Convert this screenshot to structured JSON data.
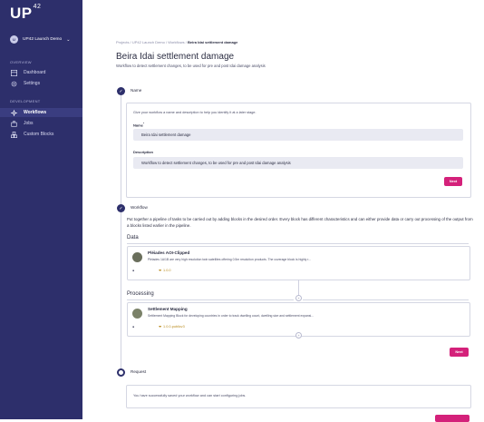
{
  "sidebar": {
    "logo": "UP",
    "logo_sup": "42",
    "project": {
      "initial": "U",
      "name": "UP42 Launch Demo"
    },
    "sections": [
      {
        "label": "OVERVIEW",
        "items": [
          {
            "icon": "dashboard-icon",
            "label": "Dashboard"
          },
          {
            "icon": "settings-icon",
            "label": "Settings"
          }
        ]
      },
      {
        "label": "DEVELOPMENT",
        "items": [
          {
            "icon": "workflows-icon",
            "label": "Workflows",
            "active": true
          },
          {
            "icon": "jobs-icon",
            "label": "Jobs"
          },
          {
            "icon": "blocks-icon",
            "label": "Custom Blocks"
          }
        ]
      }
    ]
  },
  "breadcrumb": {
    "items": [
      "Projects",
      "UP42 Launch Demo",
      "Workflows"
    ],
    "current": "Beira Idai settlement damage",
    "sep": "/"
  },
  "header": {
    "title": "Beira Idai settlement damage",
    "subtitle": "Workflow to detect settlement changes, to be used for pre and post Idai damage analysis"
  },
  "steps": {
    "name": {
      "label": "Name",
      "hint": "Give your workflow a name and description to help you identify it at a later stage.",
      "name_label": "Name",
      "name_value": "Beira Idai settlement damage",
      "desc_label": "Description",
      "desc_value": "Workflow to detect settlement changes, to be used for pre and post Idai damage analysis",
      "next": "Next"
    },
    "workflow": {
      "label": "Workflow",
      "description": "Put together a pipeline of tasks to be carried out by adding blocks in the desired order. Every block has different characteristics and can either provide data or carry out processing of the output from a blocks listed earlier in the pipeline.",
      "data_heading": "Data",
      "processing_heading": "Processing",
      "blocks": [
        {
          "name": "Pléiades AOI-Clipped",
          "desc": "Pléiades 1A/1B are very high resolution twin satellites offering 0.5m resolution products. The coverage block is highly r...",
          "version": "1.0.0"
        },
        {
          "name": "Settlement Mapping",
          "desc": "Settlement Mapping Block for developing countries in order to track dwelling count, dwelling size and settlement expansi...",
          "version": "1.0.0-publicv3"
        }
      ],
      "next": "Next"
    },
    "request": {
      "label": "Request",
      "message": "You have successfully saved your workflow and can start configuring jobs."
    }
  }
}
